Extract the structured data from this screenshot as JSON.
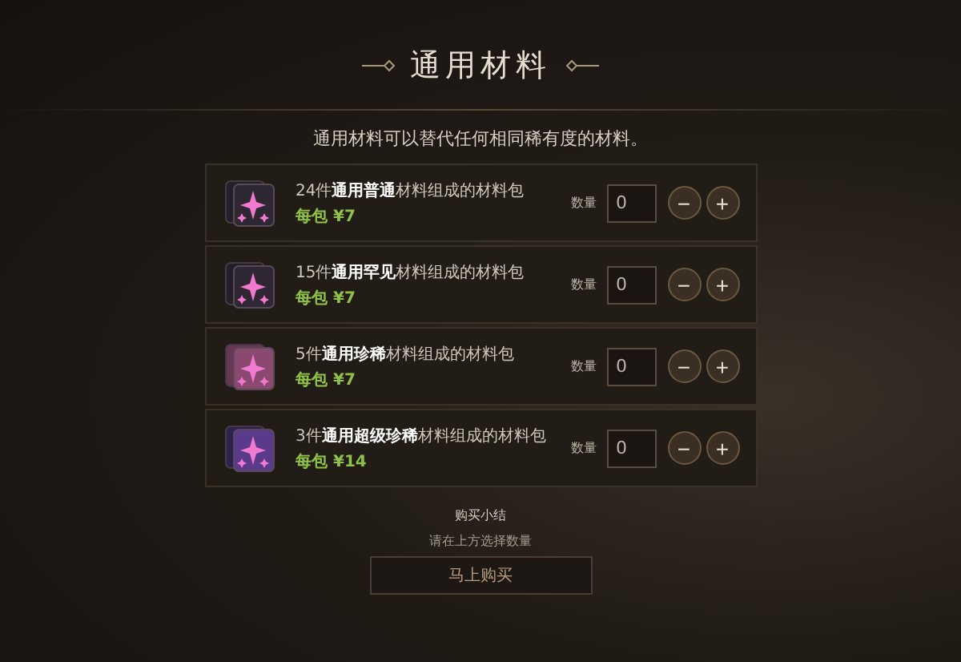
{
  "title": "通用材料",
  "subtitle": "通用材料可以替代任何相同稀有度的材料。",
  "packs": [
    {
      "kind": "common",
      "name": "24件**通用普通**材料组成的材料包",
      "price": "每包 ¥7",
      "quantity_label": "数量",
      "quantity": "0",
      "minus": "−",
      "plus": "+"
    },
    {
      "kind": "uncommon",
      "name": "15件**通用罕见**材料组成的材料包",
      "price": "每包 ¥7",
      "quantity_label": "数量",
      "quantity": "0",
      "minus": "−",
      "plus": "+"
    },
    {
      "kind": "rare",
      "name": "5件**通用珍稀**材料组成的材料包",
      "price": "每包 ¥7",
      "quantity_label": "数量",
      "quantity": "0",
      "minus": "−",
      "plus": "+"
    },
    {
      "kind": "epic",
      "name": "3件**通用超级珍稀**材料组成的材料包",
      "price": "每包 ¥14",
      "quantity_label": "数量",
      "quantity": "0",
      "minus": "−",
      "plus": "+"
    }
  ],
  "summary": {
    "title": "购买小结",
    "hint": "请在上方选择数量",
    "button": "马上购买"
  }
}
